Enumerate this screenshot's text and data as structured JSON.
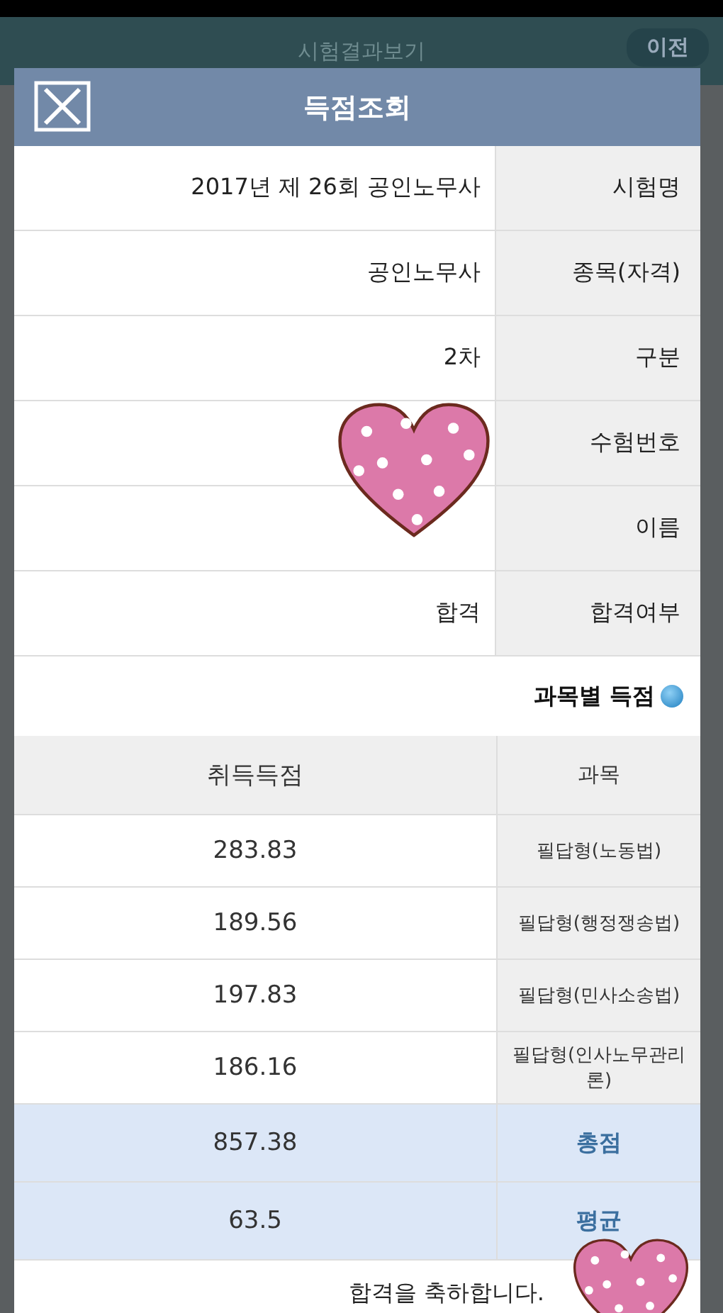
{
  "background": {
    "title": "시험결과보기",
    "back_button": "이전"
  },
  "dialog": {
    "title": "득점조회",
    "info": [
      {
        "label": "시험명",
        "value": "2017년 제 26회 공인노무사"
      },
      {
        "label": "종목(자격)",
        "value": "공인노무사"
      },
      {
        "label": "구분",
        "value": "2차"
      },
      {
        "label": "수험번호"
      },
      {
        "label": "이름"
      },
      {
        "label": "합격여부",
        "value": "합격"
      }
    ],
    "section_title": "과목별 득점",
    "table": {
      "columns": [
        "취득득점",
        "과목"
      ],
      "rows": [
        {
          "kind": "subject",
          "subject": "필답형(노동법)",
          "score": "283.83"
        },
        {
          "kind": "subject",
          "subject": "필답형(행정쟁송법)",
          "score": "189.56"
        },
        {
          "kind": "subject",
          "subject": "필답형(민사소송법)",
          "score": "197.83"
        },
        {
          "kind": "subject",
          "subject": "필답형(인사노무관리론)",
          "score": "186.16"
        },
        {
          "kind": "summary",
          "subject": "총점",
          "score": "857.38"
        },
        {
          "kind": "summary",
          "subject": "평균",
          "score": "63.5"
        }
      ]
    },
    "message": "합격을 축하합니다."
  }
}
